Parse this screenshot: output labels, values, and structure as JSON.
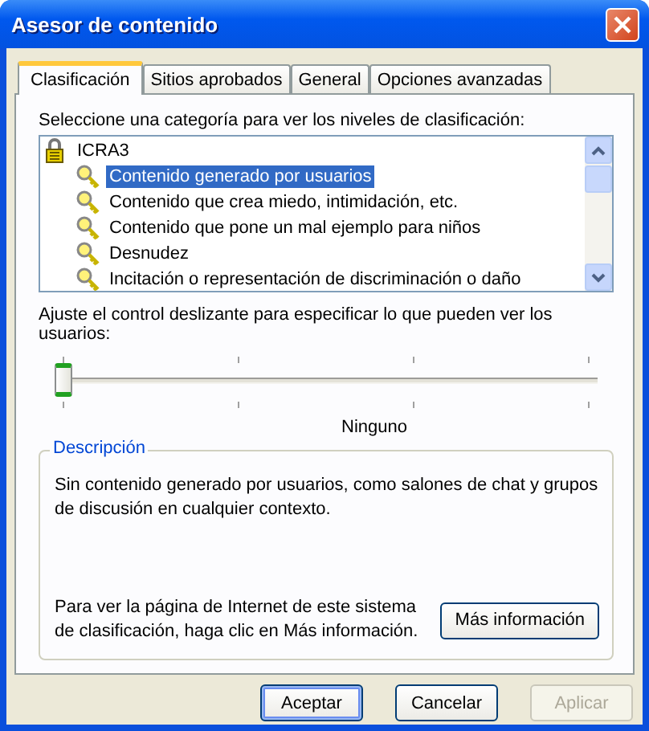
{
  "window": {
    "title": "Asesor de contenido"
  },
  "tabs": [
    {
      "label": "Clasificación",
      "selected": true
    },
    {
      "label": "Sitios aprobados",
      "selected": false
    },
    {
      "label": "General",
      "selected": false
    },
    {
      "label": "Opciones avanzadas",
      "selected": false
    }
  ],
  "category_prompt": "Seleccione una categoría para ver los niveles de clasificación:",
  "tree": {
    "label": "ICRA3",
    "children": [
      {
        "label": "Contenido generado por usuarios",
        "selected": true
      },
      {
        "label": "Contenido que crea miedo, intimidación, etc.",
        "selected": false
      },
      {
        "label": "Contenido que pone un mal ejemplo para niños",
        "selected": false
      },
      {
        "label": "Desnudez",
        "selected": false
      },
      {
        "label": "Incitación o representación de discriminación o daño",
        "selected": false
      }
    ]
  },
  "slider_prompt": "Ajuste el control deslizante para especificar lo que pueden ver los usuarios:",
  "slider": {
    "level": 0,
    "reading": "Ninguno"
  },
  "description": {
    "title": "Descripción",
    "text": "Sin contenido generado por usuarios, como salones de chat y grupos de discusión en cualquier contexto.",
    "info_text": "Para ver la página de Internet de este sistema de clasificación, haga clic en Más información.",
    "info_button": "Más información"
  },
  "buttons": [
    {
      "label": "Aceptar",
      "default": true,
      "disabled": false
    },
    {
      "label": "Cancelar",
      "default": false,
      "disabled": false
    },
    {
      "label": "Aplicar",
      "default": false,
      "disabled": true
    }
  ]
}
